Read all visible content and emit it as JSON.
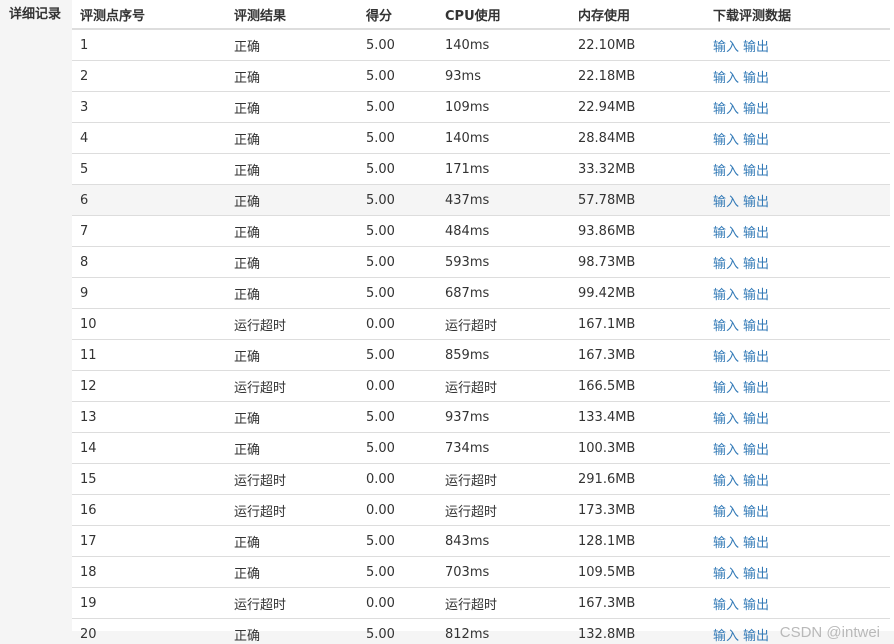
{
  "section_label": "详细记录",
  "table": {
    "headers": [
      "评测点序号",
      "评测结果",
      "得分",
      "CPU使用",
      "内存使用",
      "下载评测数据"
    ],
    "input_label": "输入",
    "output_label": "输出",
    "rows": [
      {
        "no": "1",
        "result": "正确",
        "score": "5.00",
        "cpu": "140ms",
        "mem": "22.10MB"
      },
      {
        "no": "2",
        "result": "正确",
        "score": "5.00",
        "cpu": "93ms",
        "mem": "22.18MB"
      },
      {
        "no": "3",
        "result": "正确",
        "score": "5.00",
        "cpu": "109ms",
        "mem": "22.94MB"
      },
      {
        "no": "4",
        "result": "正确",
        "score": "5.00",
        "cpu": "140ms",
        "mem": "28.84MB"
      },
      {
        "no": "5",
        "result": "正确",
        "score": "5.00",
        "cpu": "171ms",
        "mem": "33.32MB"
      },
      {
        "no": "6",
        "result": "正确",
        "score": "5.00",
        "cpu": "437ms",
        "mem": "57.78MB"
      },
      {
        "no": "7",
        "result": "正确",
        "score": "5.00",
        "cpu": "484ms",
        "mem": "93.86MB"
      },
      {
        "no": "8",
        "result": "正确",
        "score": "5.00",
        "cpu": "593ms",
        "mem": "98.73MB"
      },
      {
        "no": "9",
        "result": "正确",
        "score": "5.00",
        "cpu": "687ms",
        "mem": "99.42MB"
      },
      {
        "no": "10",
        "result": "运行超时",
        "score": "0.00",
        "cpu": "运行超时",
        "mem": "167.1MB"
      },
      {
        "no": "11",
        "result": "正确",
        "score": "5.00",
        "cpu": "859ms",
        "mem": "167.3MB"
      },
      {
        "no": "12",
        "result": "运行超时",
        "score": "0.00",
        "cpu": "运行超时",
        "mem": "166.5MB"
      },
      {
        "no": "13",
        "result": "正确",
        "score": "5.00",
        "cpu": "937ms",
        "mem": "133.4MB"
      },
      {
        "no": "14",
        "result": "正确",
        "score": "5.00",
        "cpu": "734ms",
        "mem": "100.3MB"
      },
      {
        "no": "15",
        "result": "运行超时",
        "score": "0.00",
        "cpu": "运行超时",
        "mem": "291.6MB"
      },
      {
        "no": "16",
        "result": "运行超时",
        "score": "0.00",
        "cpu": "运行超时",
        "mem": "173.3MB"
      },
      {
        "no": "17",
        "result": "正确",
        "score": "5.00",
        "cpu": "843ms",
        "mem": "128.1MB"
      },
      {
        "no": "18",
        "result": "正确",
        "score": "5.00",
        "cpu": "703ms",
        "mem": "109.5MB"
      },
      {
        "no": "19",
        "result": "运行超时",
        "score": "0.00",
        "cpu": "运行超时",
        "mem": "167.3MB"
      },
      {
        "no": "20",
        "result": "正确",
        "score": "5.00",
        "cpu": "812ms",
        "mem": "132.8MB"
      }
    ],
    "hovered_row_index": 5
  },
  "watermark": "CSDN @intwei",
  "colors": {
    "link": "#337ab7",
    "row_highlight": "#f5f5f5",
    "border": "#dddddd"
  }
}
